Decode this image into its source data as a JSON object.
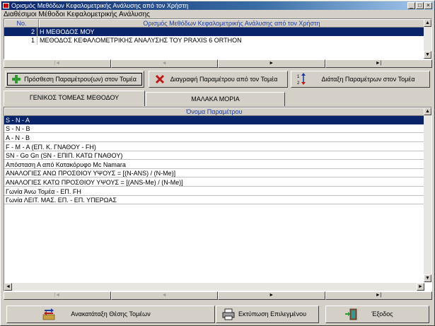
{
  "window": {
    "title": "Ορισμός Μεθόδων Κεφαλομετρικής Ανάλυσης από τον Χρήστη",
    "minimize": "_",
    "maximize": "□",
    "close": "×"
  },
  "caption": "Διαθέσιμοι Μέθοδοι Κεφαλομετρικής Ανάλυσης",
  "methods_grid": {
    "col_no": "No.",
    "col_name": "Ορισμός Μεθόδων Κεφαλομετρικής Ανάλυσης από τον Χρήστη",
    "rows": [
      {
        "no": "2",
        "name": "Η ΜΕΘΟΔΟΣ ΜΟΥ",
        "selected": true
      },
      {
        "no": "1",
        "name": "ΜΕΘΟΔΟΣ ΚΕΦΑΛΟΜΕΤΡΙΚΗΣ ΑΝΑΛΥΣΗΣ ΤΟΥ PRAXIS 6 ORTHON",
        "selected": false
      }
    ]
  },
  "nav": {
    "first": "|◄",
    "prev": "◄",
    "next": "►",
    "last": "►|"
  },
  "scroll": {
    "up": "▲",
    "down": "▼"
  },
  "actions": {
    "add": "Πρόσθεση Παραμέτρου(ων) στον Τομέα",
    "delete": "Διαγραφή Παραμέτρου από τον Τομέα",
    "arrange": "Διάταξη Παραμέτρων στον Τομέα"
  },
  "tabs": [
    {
      "label": "ΓΕΝΙΚΟΣ ΤΟΜΕΑΣ ΜΕΘΟΔΟΥ",
      "active": true
    },
    {
      "label": "ΜΑΛΑΚΑ ΜΟΡΙΑ",
      "active": false
    }
  ],
  "params_grid": {
    "header": "Όνομα Παραμέτρου",
    "rows": [
      "S - N - A",
      "S - N - B",
      "A - N - B",
      "F - M - A  (ΕΠ. Κ. ΓΝΑΘΟΥ - FH)",
      "SN - Go Gn (SN - ΕΠΙΠ. ΚΑΤΩ ΓΝΑΘΟΥ)",
      "Απόσταση Α από Κατακόρυφο Mc Namara",
      "ΑΝΑΛΟΓΙΕΣ ΑΝΩ ΠΡΟΣΘΙΟΥ ΥΨΟΥΣ = [(N-ANS) / (N-Me)]",
      "ΑΝΑΛΟΓΙΕΣ ΚΑΤΩ ΠΡΟΣΘΙΟΥ ΥΨΟΥΣ = [(ANS-Me) / (N-Me)]",
      "Γωνία Άνω Τομέα - ΕΠ. FH",
      "Γωνία ΛΕΙΤ. ΜΑΣ. ΕΠ. - ΕΠ. ΥΠΕΡΩΑΣ"
    ],
    "selected_index": 0
  },
  "bottom": {
    "reorder": "Ανακατάταξη Θέσης Τομέων",
    "print": "Εκτύπωση Επιλεγμένου",
    "exit": "Έξοδος"
  },
  "colors": {
    "selection": "#0a246a",
    "header_text": "#1a3aa0",
    "face": "#d4d0c8"
  }
}
